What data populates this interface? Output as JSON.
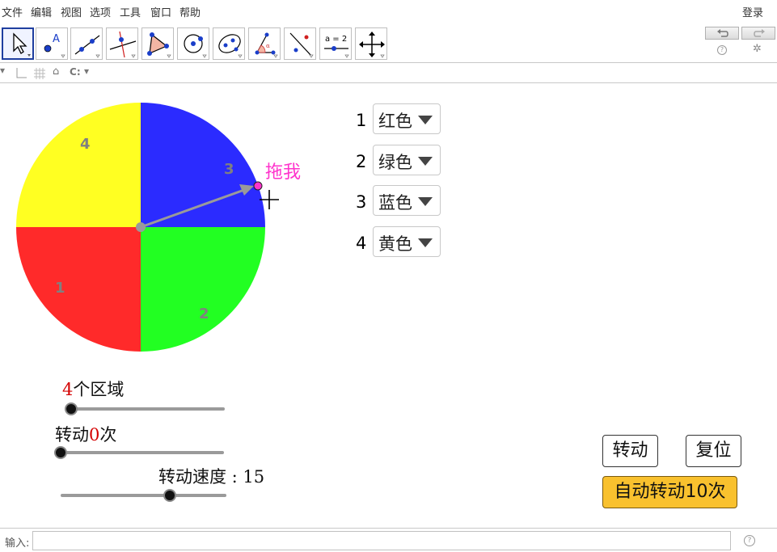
{
  "menu": {
    "items": [
      "文件",
      "编辑",
      "视图",
      "选项",
      "工具",
      "窗口",
      "帮助"
    ],
    "login": "登录"
  },
  "toolbar": {
    "tools": [
      "move-tool",
      "point-tool",
      "line-tool",
      "perpendicular-line-tool",
      "polygon-tool",
      "circle-center-point-tool",
      "conic-tool",
      "angle-tool",
      "reflect-tool",
      "slider-tool",
      "move-graphics-view-tool"
    ],
    "slider_tool_text": "a = 2"
  },
  "stylebar": {
    "grid_toggle": "C",
    "grid_toggle_suffix": ":"
  },
  "spinner": {
    "sectors": [
      {
        "label": "1",
        "color": "#ff2a2a"
      },
      {
        "label": "2",
        "color": "#22ff22"
      },
      {
        "label": "3",
        "color": "#2b2bff"
      },
      {
        "label": "4",
        "color": "#ffff22"
      }
    ],
    "drag_label": "拖我",
    "pointer_color": "#9a9a9a",
    "drag_point_color": "#ff33cc"
  },
  "color_rows": [
    {
      "num": "1",
      "value": "红色"
    },
    {
      "num": "2",
      "value": "绿色"
    },
    {
      "num": "3",
      "value": "蓝色"
    },
    {
      "num": "4",
      "value": "黄色"
    }
  ],
  "sliders": {
    "regions": {
      "value": "4",
      "suffix": "个区域",
      "level": 0.0
    },
    "spins": {
      "prefix": "转动",
      "value": "0",
      "suffix": "次",
      "level": 0.0
    },
    "speed": {
      "label": "转动速度 : 15",
      "level": 0.66
    }
  },
  "buttons": {
    "spin": "转动",
    "reset": "复位",
    "auto": "自动转动10次"
  },
  "inputbar": {
    "label": "输入:",
    "placeholder": ""
  }
}
